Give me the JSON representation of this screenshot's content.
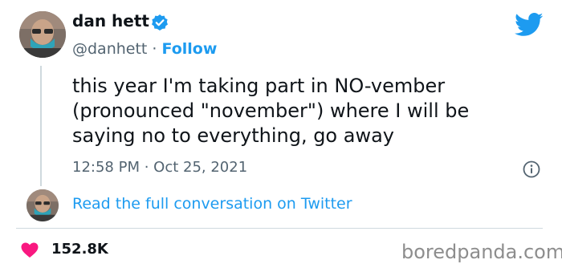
{
  "author": {
    "name": "dan hett",
    "handle": "@danhett",
    "separator": " · ",
    "follow_label": "Follow"
  },
  "tweet": {
    "text": "this year I'm taking part in NO-vember\n(pronounced \"november\") where I will be\nsaying no to everything, go away",
    "timestamp": "12:58 PM · Oct 25, 2021"
  },
  "thread": {
    "read_link": "Read the full conversation on Twitter"
  },
  "footer": {
    "likes": "152.8K",
    "watermark": "boredpanda.com"
  },
  "colors": {
    "accent": "#1d9bf0",
    "like": "#f91880",
    "muted": "#536471"
  },
  "icons": {
    "verified": "verified-badge-icon",
    "brand": "twitter-bird-icon",
    "info": "info-icon",
    "like": "heart-icon"
  }
}
